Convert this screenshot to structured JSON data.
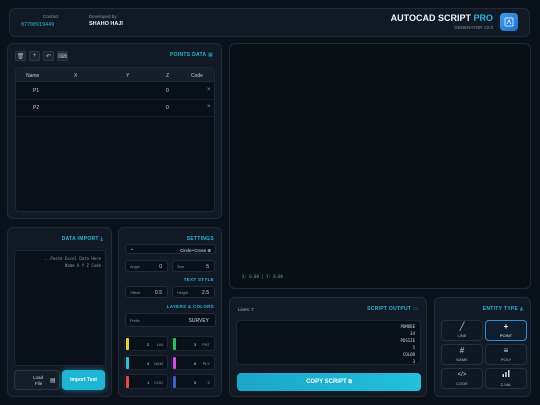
{
  "header": {
    "contact_label": "Contact",
    "contact_value": "07700919449",
    "developed_label": "Developed by",
    "developer": "SHAHO HAJI",
    "app_title": "AUTOCAD SCRIPT",
    "app_title_accent": "PRO",
    "generator_version": "GENERATOR V2.0"
  },
  "points": {
    "section_title": "POINTS DATA",
    "columns": [
      "Name",
      "X",
      "Y",
      "Z",
      "Code"
    ],
    "rows": [
      {
        "name": "P1",
        "z": "0",
        "delete": "×"
      },
      {
        "name": "P2",
        "z": "0",
        "delete": "×"
      }
    ]
  },
  "canvas": {
    "coords": "X: 0.00 | Y: 0.00"
  },
  "import": {
    "section_title": "DATA IMPORT",
    "paste_placeholder_line1": "...Paste Excel Data Here",
    "paste_placeholder_line2": "Name X Y Z Code",
    "load_line1": "Load",
    "load_line2": "File",
    "import_button": "Import Text"
  },
  "settings": {
    "section_title": "SETTINGS",
    "symbol_value": "Circle+Cross ⊕",
    "angle_label": "Angle",
    "angle_value": "0",
    "size_label": "Size",
    "size_value": "5",
    "text_style_title": "TEXT STYLE",
    "offset_label": "Offset",
    "offset_value": "0.5",
    "height_label": "Height",
    "height_value": "2.5",
    "layers_title": "LAYERS & COLORS",
    "prefix_label": "Prefix",
    "prefix_value": "SURVEY",
    "layers": [
      {
        "num": "2",
        "code": "LIN",
        "color": "#e8d21c"
      },
      {
        "num": "3",
        "code": "PNT",
        "color": "#22c55e"
      },
      {
        "num": "4",
        "code": "NAM",
        "color": "#22c5e0"
      },
      {
        "num": "6",
        "code": "PLY",
        "color": "#d946ef"
      },
      {
        "num": "1",
        "code": "COD",
        "color": "#ef4444"
      },
      {
        "num": "5",
        "code": "Z",
        "color": "#3b5bdb"
      }
    ]
  },
  "output": {
    "lines_label": "Lines: 7",
    "section_title": "SCRIPT OUTPUT",
    "script_lines": [
      "PDMODE",
      "34",
      "PDSIZE",
      "5",
      "COLOR",
      "3"
    ],
    "copy_button": "COPY SCRIPT"
  },
  "entity": {
    "section_title": "ENTITY TYPE",
    "types": [
      {
        "label": "LINE",
        "icon": "slash-icon",
        "glyph": "╱"
      },
      {
        "label": "POINT",
        "icon": "plus-icon",
        "glyph": "+"
      },
      {
        "label": "NAME",
        "icon": "hash-icon",
        "glyph": "#"
      },
      {
        "label": "POLY",
        "icon": "lines-icon",
        "glyph": "≡"
      },
      {
        "label": "CODE",
        "icon": "code-icon",
        "glyph": "</>"
      },
      {
        "label": "Z-VAL",
        "icon": "bar-chart-icon",
        "glyph": "▮"
      }
    ],
    "active": "POINT"
  },
  "colors": {
    "accent": "#22b8d8",
    "background": "#0b1118",
    "panel": "#111a24"
  }
}
